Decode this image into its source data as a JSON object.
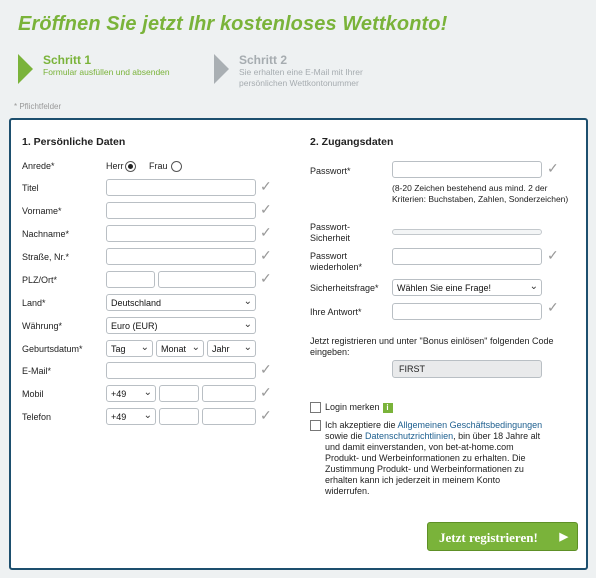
{
  "headline": "Eröffnen Sie jetzt Ihr kostenloses Wettkonto!",
  "steps": [
    {
      "title": "Schritt 1",
      "desc1": "Formular ausfüllen und absenden",
      "desc2": ""
    },
    {
      "title": "Schritt 2",
      "desc1": "Sie erhalten eine E-Mail mit Ihrer",
      "desc2": "persönlichen Wettkontonummer"
    }
  ],
  "required_note": "* Pflichtfelder",
  "personal": {
    "title": "1. Persönliche Daten",
    "salutation_label": "Anrede*",
    "herr": "Herr",
    "frau": "Frau",
    "title_label": "Titel",
    "firstname_label": "Vorname*",
    "lastname_label": "Nachname*",
    "street_label": "Straße, Nr.*",
    "zip_label": "PLZ/Ort*",
    "country_label": "Land*",
    "country_value": "Deutschland",
    "currency_label": "Währung*",
    "currency_value": "Euro (EUR)",
    "birthday_label": "Geburtsdatum*",
    "day_value": "Tag",
    "month_value": "Monat",
    "year_value": "Jahr",
    "email_label": "E-Mail*",
    "mobile_label": "Mobil",
    "mobile_prefix": "+49",
    "phone_label": "Telefon",
    "phone_prefix": "+49"
  },
  "access": {
    "title": "2. Zugangsdaten",
    "password_label": "Passwort*",
    "password_hint": "(8-20 Zeichen bestehend aus mind. 2 der Kriterien: Buchstaben, Zahlen, Sonderzeichen)",
    "strength_label1": "Passwort-",
    "strength_label2": "Sicherheit",
    "repeat_label1": "Passwort",
    "repeat_label2": "wiederholen*",
    "question_label": "Sicherheitsfrage*",
    "question_value": "Wählen Sie eine Frage!",
    "answer_label": "Ihre Antwort*",
    "bonus_text": "Jetzt registrieren und unter \"Bonus einlösen\" folgenden Code eingeben:",
    "bonus_code": "FIRST",
    "remember_label": "Login merken",
    "remember_info": "i",
    "terms_prefix": "Ich akzeptiere die ",
    "terms_link": "Allgemeinen Geschäftsbedingungen",
    "terms_middle": " sowie die ",
    "privacy_link": "Datenschutzrichtlinien",
    "terms_suffix": ", bin über 18 Jahre alt und damit einverstanden, von bet-at-home.com Produkt- und Werbeinformationen zu erhalten. Die Zustimmung Produkt- und Werbeinformationen zu erhalten kann ich jederzeit in meinem Konto widerrufen."
  },
  "submit_label": "Jetzt registrieren!",
  "check_glyph": "✓",
  "accent_color": "#7ab33a",
  "border_color": "#1d4f6e"
}
